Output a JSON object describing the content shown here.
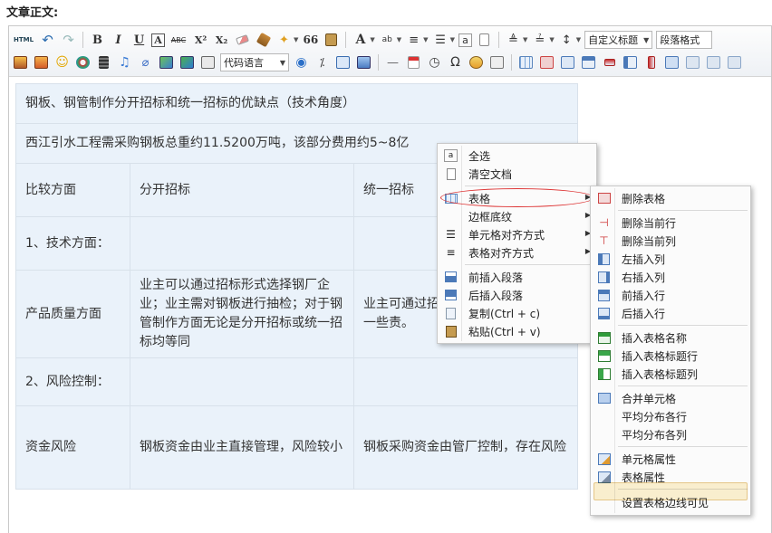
{
  "page": {
    "label": "文章正文:"
  },
  "toolbar": {
    "html_label": "HTML",
    "bold": "B",
    "italic": "I",
    "underline": "U",
    "border_text": "A",
    "strike": "ABC",
    "superscript": "X²",
    "subscript": "X₂",
    "quote": "66",
    "font_color": "A",
    "custom_heading": "自定义标题",
    "paragraph_format": "段落格式",
    "code_language": "代码语言"
  },
  "document": {
    "title_row": "钢板、钢管制作分开招标和统一招标的优缺点（技术角度）",
    "intro_row": "西江引水工程需采购钢板总重约11.5200万吨，该部分费用约5~8亿",
    "header": [
      "比较方面",
      "分开招标",
      "统一招标"
    ],
    "rows": [
      [
        "1、技术方面：",
        "",
        ""
      ],
      [
        "产品质量方面",
        "业主可以通过招标形式选择钢厂企业；业主需对钢板进行抽检；对于钢管制作方面无论是分开招标或统一招标均等同",
        "业主可通过招标制钢板质量，控制的一些责。"
      ],
      [
        "2、风险控制：",
        "",
        ""
      ],
      [
        "资金风险",
        "钢板资金由业主直接管理，风险较小",
        "钢板采购资金由管厂控制，存在风险"
      ]
    ]
  },
  "context_menu": {
    "items": [
      {
        "label": "全选",
        "icon": "select-all-icon"
      },
      {
        "label": "清空文档",
        "icon": "clear-document-icon"
      },
      {
        "label": "表格",
        "icon": "table-icon",
        "submenu": true,
        "highlighted": true
      },
      {
        "label": "边框底纹",
        "icon": "",
        "submenu": true
      },
      {
        "label": "单元格对齐方式",
        "icon": "align-cell-icon",
        "submenu": true
      },
      {
        "label": "表格对齐方式",
        "icon": "align-table-icon",
        "submenu": true
      },
      {
        "label": "前插入段落",
        "icon": "insert-paragraph-before-icon"
      },
      {
        "label": "后插入段落",
        "icon": "insert-paragraph-after-icon"
      },
      {
        "label": "复制(Ctrl + c)",
        "icon": "copy-icon"
      },
      {
        "label": "粘贴(Ctrl + v)",
        "icon": "paste-icon"
      }
    ]
  },
  "table_submenu": {
    "items": [
      {
        "label": "删除表格",
        "icon": "delete-table-icon"
      },
      {
        "label": "删除当前行",
        "icon": "delete-row-icon"
      },
      {
        "label": "删除当前列",
        "icon": "delete-column-icon"
      },
      {
        "label": "左插入列",
        "icon": "insert-column-left-icon"
      },
      {
        "label": "右插入列",
        "icon": "insert-column-right-icon"
      },
      {
        "label": "前插入行",
        "icon": "insert-row-above-icon"
      },
      {
        "label": "后插入行",
        "icon": "insert-row-below-icon"
      },
      {
        "label": "插入表格名称",
        "icon": "insert-caption-icon"
      },
      {
        "label": "插入表格标题行",
        "icon": "insert-title-row-icon"
      },
      {
        "label": "插入表格标题列",
        "icon": "insert-title-column-icon"
      },
      {
        "label": "合并单元格",
        "icon": "merge-cells-icon"
      },
      {
        "label": "平均分布各行",
        "icon": ""
      },
      {
        "label": "平均分布各列",
        "icon": ""
      },
      {
        "label": "单元格属性",
        "icon": "cell-properties-icon"
      },
      {
        "label": "表格属性",
        "icon": "table-properties-icon"
      },
      {
        "label": "设置表格边线可见",
        "icon": "",
        "highlighted": true
      }
    ]
  },
  "colors": {
    "table_cell_bg": "#eaf2fa",
    "table_border": "#d8e1ea",
    "highlight_red": "#dd3333",
    "hover_bg": "#fdf2d2"
  }
}
